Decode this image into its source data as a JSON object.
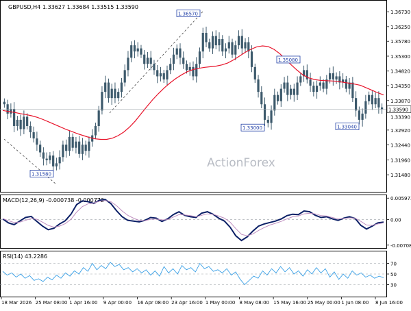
{
  "header": {
    "symbol_tf": "GBPUSD,H4",
    "ohlc": "1.33627 1.33684 1.33515 1.33590"
  },
  "watermark": "ActionForex",
  "colors": {
    "candle": "#3d5a6c",
    "ma": "#e8132a",
    "trendline": "#333333",
    "macd_line": "#0b1f66",
    "macd_signal": "#c090c0",
    "rsi_line": "#3aa0e6",
    "grid": "#9aa0a6",
    "label_box": "#1f3ea6"
  },
  "chart_data": [
    {
      "type": "candlestick",
      "title": "GBPUSD,H4",
      "ylim": [
        1.3102,
        1.3702
      ],
      "y_ticks": [
        "1.33870",
        "1.34350",
        "1.34820",
        "1.35300",
        "1.35780",
        "1.36250",
        "1.36730",
        "1.32920",
        "1.32440",
        "1.31960",
        "1.31480",
        "1.33390"
      ],
      "y_tick_values": [
        1.3387,
        1.3435,
        1.3482,
        1.353,
        1.3578,
        1.3625,
        1.3673,
        1.3292,
        1.3244,
        1.3196,
        1.3148,
        1.3339
      ],
      "current_price_label": "1.33590",
      "current_price": 1.3359,
      "annotations": [
        {
          "label": "1.36570",
          "value": 1.3657
        },
        {
          "label": "1.35080",
          "value": 1.3508
        },
        {
          "label": "1.33000",
          "value": 1.33
        },
        {
          "label": "1.33040",
          "value": 1.3304
        },
        {
          "label": "1.31580",
          "value": 1.3158
        }
      ],
      "series": [
        {
          "kind": "ohlc_close_path",
          "values": [
            1.3375,
            1.3345,
            1.336,
            1.3305,
            1.3325,
            1.3295,
            1.3335,
            1.3305,
            1.3285,
            1.3265,
            1.3245,
            1.322,
            1.32,
            1.3195,
            1.321,
            1.3175,
            1.3185,
            1.3205,
            1.3245,
            1.3225,
            1.327,
            1.3235,
            1.3255,
            1.3215,
            1.3245,
            1.3225,
            1.3255,
            1.3275,
            1.3305,
            1.3355,
            1.3415,
            1.3445,
            1.3395,
            1.3425,
            1.3395,
            1.3415,
            1.3445,
            1.3485,
            1.3525,
            1.3565,
            1.3545,
            1.3555,
            1.3535,
            1.3505,
            1.3525,
            1.3505,
            1.3485,
            1.3465,
            1.3475,
            1.3455,
            1.3485,
            1.3505,
            1.3535,
            1.3555,
            1.3525,
            1.3505,
            1.3485,
            1.3495,
            1.3465,
            1.3505,
            1.3545,
            1.3605,
            1.3575,
            1.3555,
            1.3595,
            1.3565,
            1.3585,
            1.3545,
            1.3555,
            1.3575,
            1.3535,
            1.3565,
            1.3595,
            1.3555,
            1.3575,
            1.3545,
            1.3495,
            1.3455,
            1.3415,
            1.3375,
            1.3325,
            1.3315,
            1.3355,
            1.3405,
            1.3385,
            1.3425,
            1.3445,
            1.3405,
            1.3425,
            1.3405,
            1.3445,
            1.3465,
            1.3485,
            1.3455,
            1.3435,
            1.3415,
            1.3435,
            1.3445,
            1.3425,
            1.3455,
            1.3475,
            1.3455,
            1.3465,
            1.3445,
            1.3455,
            1.3425,
            1.3445,
            1.3395,
            1.3355,
            1.3325,
            1.3345,
            1.3385,
            1.3405,
            1.3375,
            1.3395,
            1.3365,
            1.3359
          ]
        },
        {
          "kind": "ma",
          "values": [
            1.3355,
            1.3352,
            1.3349,
            1.3345,
            1.3342,
            1.3338,
            1.3333,
            1.3326,
            1.3318,
            1.331,
            1.3302,
            1.3294,
            1.3287,
            1.328,
            1.3274,
            1.3268,
            1.3264,
            1.3262,
            1.3262,
            1.3266,
            1.3274,
            1.3286,
            1.3302,
            1.3322,
            1.3345,
            1.3368,
            1.339,
            1.341,
            1.3428,
            1.3444,
            1.3458,
            1.347,
            1.348,
            1.3487,
            1.3491,
            1.3494,
            1.3496,
            1.3498,
            1.3502,
            1.3508,
            1.3518,
            1.353,
            1.3542,
            1.3552,
            1.356,
            1.3563,
            1.3561,
            1.3552,
            1.3538,
            1.352,
            1.3502,
            1.3485,
            1.347,
            1.346,
            1.3455,
            1.3452,
            1.3451,
            1.345,
            1.3449,
            1.3446,
            1.3443,
            1.344,
            1.3436,
            1.3428,
            1.342,
            1.3412,
            1.3405
          ]
        }
      ]
    },
    {
      "type": "line",
      "title": "MACD(12,26,9) -0.000738 -0.000772",
      "ylim": [
        -0.0075,
        0.0064
      ],
      "y_ticks": [
        "0.005973",
        "0.00",
        "-0.007086"
      ],
      "y_tick_values": [
        0.005973,
        0.0,
        -0.007086
      ],
      "series": [
        {
          "name": "MACD",
          "values": [
            0.0002,
            -0.0009,
            -0.0014,
            -0.0004,
            0.0006,
            0.0009,
            -0.0005,
            -0.0018,
            -0.0028,
            -0.0024,
            -0.0012,
            -0.0003,
            0.0015,
            0.0042,
            0.0052,
            0.005,
            0.0045,
            0.0054,
            0.0056,
            0.0045,
            0.0025,
            0.0008,
            -0.0002,
            -0.0004,
            -0.0006,
            -0.0002,
            0.0006,
            0.0004,
            -0.0005,
            0.0002,
            0.0014,
            0.0022,
            0.0012,
            0.0008,
            0.0006,
            0.0018,
            0.0022,
            0.0015,
            0.0004,
            -0.0004,
            -0.0021,
            -0.0045,
            -0.0058,
            -0.0048,
            -0.0032,
            -0.0018,
            -0.0012,
            -0.0008,
            -0.0004,
            0.0002,
            0.0011,
            0.0015,
            0.0014,
            0.0024,
            0.0022,
            0.0012,
            0.0006,
            0.0008,
            0.0002,
            -0.0002,
            0.0004,
            0.0008,
            0.0003,
            -0.0016,
            -0.0026,
            -0.0018,
            -0.0009,
            -0.0007
          ]
        },
        {
          "name": "Signal",
          "values": [
            0.0003,
            -0.0003,
            -0.0008,
            -0.0007,
            -0.0002,
            0.0003,
            0.0001,
            -0.0007,
            -0.0016,
            -0.0021,
            -0.0018,
            -0.0011,
            0.0001,
            0.0021,
            0.0036,
            0.0044,
            0.0046,
            0.0051,
            0.0053,
            0.005,
            0.0039,
            0.0024,
            0.0012,
            0.0004,
            -0.0002,
            -0.0003,
            0.0001,
            0.0002,
            -0.0001,
            0.0,
            0.0007,
            0.0014,
            0.0013,
            0.0011,
            0.0008,
            0.0012,
            0.0016,
            0.0015,
            0.001,
            0.0004,
            -0.0007,
            -0.0025,
            -0.0041,
            -0.0045,
            -0.004,
            -0.003,
            -0.0022,
            -0.0015,
            -0.001,
            -0.0005,
            0.0002,
            0.0008,
            0.001,
            0.0016,
            0.0018,
            0.0016,
            0.0011,
            0.001,
            0.0006,
            0.0002,
            0.0003,
            0.0005,
            0.0004,
            -0.0005,
            -0.0015,
            -0.0016,
            -0.0012,
            -0.0009
          ]
        }
      ]
    },
    {
      "type": "line",
      "title": "RSI(14) 43.2286",
      "ylim": [
        10,
        90
      ],
      "y_ticks": [
        "70",
        "50",
        "30"
      ],
      "y_tick_values": [
        70,
        50,
        30
      ],
      "series": [
        {
          "name": "RSI",
          "values": [
            55,
            48,
            52,
            44,
            50,
            42,
            47,
            38,
            41,
            36,
            44,
            39,
            48,
            42,
            52,
            46,
            56,
            50,
            62,
            55,
            70,
            58,
            66,
            60,
            72,
            64,
            68,
            58,
            62,
            54,
            60,
            52,
            58,
            48,
            56,
            46,
            64,
            52,
            60,
            50,
            66,
            58,
            62,
            54,
            70,
            60,
            64,
            55,
            58,
            52,
            60,
            48,
            54,
            40,
            30,
            38,
            46,
            42,
            56,
            48,
            60,
            52,
            64,
            54,
            62,
            50,
            56,
            46,
            58,
            50,
            62,
            52,
            60,
            44,
            54,
            40,
            50,
            42,
            56,
            48,
            52,
            44,
            48,
            42,
            46,
            43
          ]
        }
      ]
    }
  ],
  "x_axis_labels": [
    "18 Mar 2026",
    "25 Mar 08:00",
    "1 Apr 16:00",
    "9 Apr 00:00",
    "16 Apr 08:00",
    "23 Apr 16:00",
    "1 May 00:00",
    "8 May 08:00",
    "15 May 16:00",
    "25 May 00:00",
    "1 Jun 08:00",
    "8 Jun 16:00"
  ]
}
